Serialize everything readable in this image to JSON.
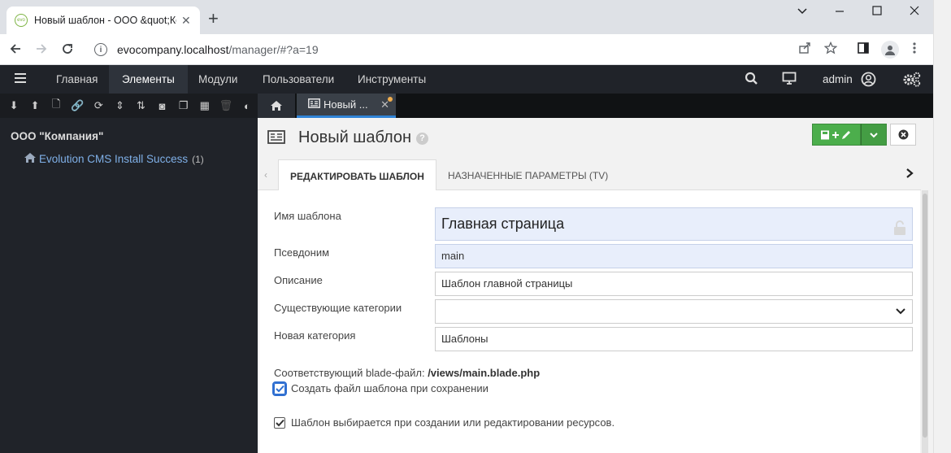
{
  "browser": {
    "tab_title": "Новый шаблон - ООО &quot;Ко",
    "favicon_text": "evo",
    "new_tab": "+",
    "url_host": "evocompany.localhost",
    "url_path": "/manager/#?a=19",
    "win_minimize": "⌵",
    "win_restore": "☐",
    "win_close": "✕"
  },
  "topnav": {
    "items": [
      "Главная",
      "Элементы",
      "Модули",
      "Пользователи",
      "Инструменты"
    ],
    "active_index": 1,
    "user": "admin",
    "icons": [
      "menu-icon",
      "search-icon",
      "monitor-icon",
      "user-circle-icon",
      "gears-icon"
    ]
  },
  "tree": {
    "toolbar_icons": [
      "expand-icon",
      "collapse-icon",
      "new-doc-icon",
      "new-weblink-icon",
      "refresh-icon",
      "sort-icon",
      "sort-order-icon",
      "camera-icon",
      "copy-icon",
      "grid-icon",
      "trash-icon",
      "contrast-icon"
    ],
    "root_label": "ООО \"Компания\"",
    "node_label": "Evolution CMS Install Success",
    "node_count": "(1)"
  },
  "doctab": {
    "label": "Новый ..."
  },
  "page": {
    "title": "Новый шаблон",
    "help": "?",
    "tabs": [
      "РЕДАКТИРОВАТЬ ШАБЛОН",
      "НАЗНАЧЕННЫЕ ПАРАМЕТРЫ (TV)"
    ],
    "active_tab": 0
  },
  "form": {
    "name_label": "Имя шаблона",
    "name_value": "Главная страница",
    "alias_label": "Псевдоним",
    "alias_value": "main",
    "desc_label": "Описание",
    "desc_value": "Шаблон главной страницы",
    "category_label": "Существующие категории",
    "category_value": "",
    "newcat_label": "Новая категория",
    "newcat_value": "Шаблоны",
    "blade_label": "Соответствующий blade-файл:",
    "blade_path": "/views/main.blade.php",
    "create_file_label": "Создать файл шаблона при сохранении",
    "create_file_checked": true,
    "selectable_label": "Шаблон выбирается при создании или редактировании ресурсов.",
    "selectable_checked": true
  },
  "colors": {
    "topnav_bg": "#202329",
    "accent_blue": "#2f83d6",
    "save_green": "#4cae4c"
  }
}
